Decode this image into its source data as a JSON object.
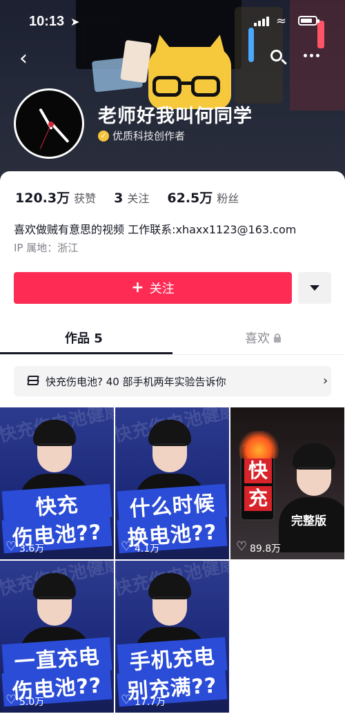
{
  "status_bar": {
    "time": "10:13"
  },
  "profile": {
    "name": "老师好我叫何同学",
    "creator_badge": "优质科技创作者",
    "stats": [
      {
        "value": "120.3万",
        "label": "获赞"
      },
      {
        "value": "3",
        "label": "关注"
      },
      {
        "value": "62.5万",
        "label": "粉丝"
      }
    ],
    "bio": "喜欢做贼有意思的视频 工作联系:xhaxx1123@163.com",
    "ip_location": "IP 属地：浙江"
  },
  "actions": {
    "follow_label": "关注",
    "follow_icon": "+"
  },
  "tabs": [
    {
      "label": "作品 5",
      "active": true
    },
    {
      "label": "喜欢",
      "locked": true
    }
  ],
  "collection": {
    "title": "快充伤电池? 40 部手机两年实验告诉你"
  },
  "videos": [
    {
      "caption_top": "快充",
      "caption_bottom": "伤电池??",
      "likes": "3.6万",
      "bg_text": "快充伤电池健康"
    },
    {
      "caption_top": "什么时候",
      "caption_bottom": "换电池??",
      "likes": "4.1万",
      "bg_text": "快充伤电池健康"
    },
    {
      "phone_text_top": "快",
      "phone_text_bottom": "充",
      "tag": "完整版",
      "likes": "89.8万"
    },
    {
      "caption_top": "一直充电",
      "caption_bottom": "伤电池??",
      "likes": "5.0万",
      "bg_text": "快充伤电池健康"
    },
    {
      "caption_top": "手机充电",
      "caption_bottom": "别充满??",
      "likes": "17.7万",
      "bg_text": "快充伤电池健康"
    }
  ],
  "colors": {
    "accent": "#fe2c55",
    "text": "#161823",
    "muted": "#80828a",
    "badge": "#f6c53d"
  }
}
